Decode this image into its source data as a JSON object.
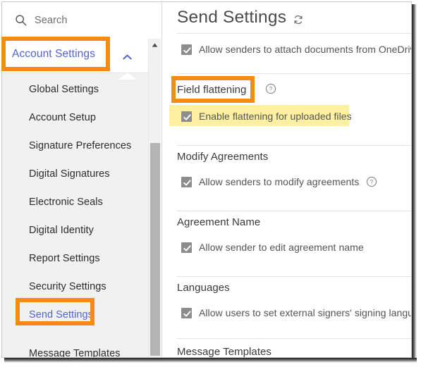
{
  "sidebar": {
    "search": {
      "placeholder": "Search",
      "icon": "search-icon"
    },
    "group_header": {
      "label": "Account Settings",
      "expand_icon": "chevron-up-icon",
      "expanded": true
    },
    "items": [
      {
        "label": "Global Settings",
        "selected": false
      },
      {
        "label": "Account Setup",
        "selected": false
      },
      {
        "label": "Signature Preferences",
        "selected": false
      },
      {
        "label": "Digital Signatures",
        "selected": false
      },
      {
        "label": "Electronic Seals",
        "selected": false
      },
      {
        "label": "Digital Identity",
        "selected": false
      },
      {
        "label": "Report Settings",
        "selected": false
      },
      {
        "label": "Security Settings",
        "selected": false
      },
      {
        "label": "Send Settings",
        "selected": true
      },
      {
        "label": "Message Templates",
        "selected": false
      }
    ],
    "scrollbar": {
      "up_arrow_icon": "caret-up-icon"
    }
  },
  "content": {
    "title": "Send Settings",
    "title_icon": "refresh-icon",
    "sections": [
      {
        "heading": "",
        "options": [
          {
            "label": "Allow senders to attach documents from OneDrive",
            "checked": true,
            "help": false
          }
        ]
      },
      {
        "heading": "Field flattening",
        "heading_help": true,
        "options": [
          {
            "label": "Enable flattening for uploaded files",
            "checked": true,
            "help": false,
            "highlighted": true
          }
        ]
      },
      {
        "heading": "Modify Agreements",
        "options": [
          {
            "label": "Allow senders to modify agreements",
            "checked": true,
            "help": true
          }
        ]
      },
      {
        "heading": "Agreement Name",
        "options": [
          {
            "label": "Allow sender to edit agreement name",
            "checked": true,
            "help": false
          }
        ]
      },
      {
        "heading": "Languages",
        "options": [
          {
            "label": "Allow users to set external signers' signing language",
            "checked": true,
            "help": false
          }
        ]
      },
      {
        "heading": "Message Templates",
        "options": []
      }
    ]
  },
  "annotations": {
    "box_color": "#f28c13",
    "highlight_color": "#fdf0a0",
    "boxes": [
      {
        "target": "account-settings-header"
      },
      {
        "target": "send-settings-sidebar-item"
      },
      {
        "target": "field-flattening-heading"
      }
    ],
    "highlights": [
      {
        "target": "enable-flattening-option"
      }
    ]
  }
}
